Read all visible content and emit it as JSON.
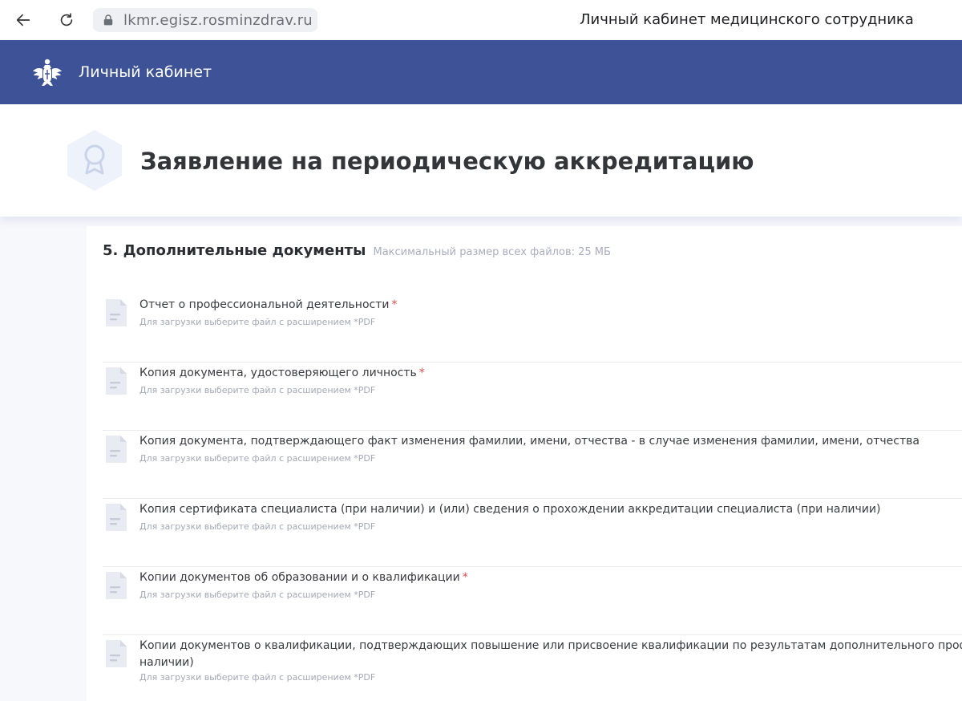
{
  "browser": {
    "url": "lkmr.egisz.rosminzdrav.ru",
    "tab_title": "Личный кабинет медицинского сотрудника"
  },
  "header": {
    "app_title": "Личный кабинет",
    "accent_color": "#3e5397"
  },
  "page": {
    "title": "Заявление на периодическую аккредитацию"
  },
  "section": {
    "title": "5. Дополнительные документы",
    "note": "Максимальный размер всех файлов: 25 МБ"
  },
  "documents": [
    {
      "label": "Отчет о профессиональной деятельности",
      "required_mark": "*",
      "hint": "Для загрузки выберите файл с расширением *PDF"
    },
    {
      "label": "Копия документа, удостоверяющего личность",
      "required_mark": "*",
      "hint": "Для загрузки выберите файл с расширением *PDF"
    },
    {
      "label": "Копия документа, подтверждающего факт изменения фамилии, имени, отчества - в случае изменения фамилии, имени, отчества",
      "required_mark": "",
      "hint": "Для загрузки выберите файл с расширением *PDF"
    },
    {
      "label": "Копия сертификата специалиста (при наличии) и (или) сведения о прохождении аккредитации специалиста (при наличии)",
      "required_mark": "",
      "hint": "Для загрузки выберите файл с расширением *PDF"
    },
    {
      "label": "Копии документов об образовании и о квалификации",
      "required_mark": "*",
      "hint": "Для загрузки выберите файл с расширением *PDF"
    },
    {
      "label": "Копии документов о квалификации, подтверждающих повышение или присвоение квалификации по результатам дополнительного проф",
      "label_line2": "наличии)",
      "required_mark": "",
      "hint": "Для загрузки выберите файл с расширением *PDF"
    }
  ],
  "icons": {
    "back": "arrow-left-icon",
    "reload": "reload-icon",
    "lock": "lock-icon",
    "logo": "emblem-icon",
    "badge": "award-ribbon-icon",
    "file": "document-icon"
  }
}
